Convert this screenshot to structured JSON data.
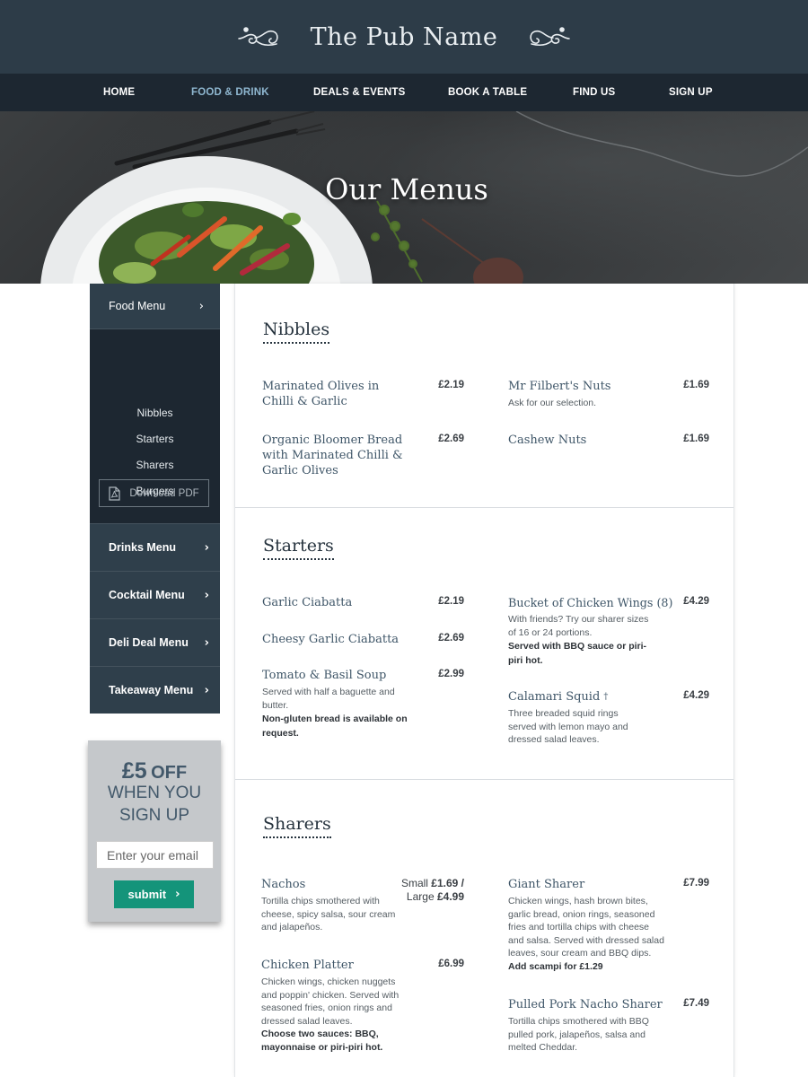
{
  "header": {
    "title": "The Pub Name"
  },
  "nav": {
    "items": [
      {
        "label": "HOME"
      },
      {
        "label": "FOOD & DRINK"
      },
      {
        "label": "DEALS & EVENTS"
      },
      {
        "label": "BOOK A TABLE"
      },
      {
        "label": "FIND US"
      },
      {
        "label": "SIGN UP"
      }
    ],
    "active": "FOOD & DRINK",
    "active_color": "#8fb7d0"
  },
  "hero": {
    "title": "Our Menus"
  },
  "sidebar": {
    "food_menu": "Food Menu",
    "sub_items": [
      "Nibbles",
      "Starters",
      "Sharers",
      "Burgers"
    ],
    "download_pdf": "Download PDF",
    "menus": [
      "Drinks Menu",
      "Cocktail Menu",
      "Deli Deal Menu",
      "Takeaway Menu"
    ],
    "chevron_icon": "chevron-right-icon"
  },
  "promo": {
    "amount": "£5",
    "off": "OFF",
    "line2": "WHEN YOU",
    "line3": "SIGN UP",
    "email_placeholder": "Enter your email",
    "submit_label": "submit",
    "submit_color": "#14947a"
  },
  "sections": {
    "nibbles": {
      "title": "Nibbles",
      "items": [
        {
          "name": "Marinated Olives in Chilli & Garlic",
          "price": "£2.19"
        },
        {
          "name": "Organic Bloomer Bread with Marinated Chilli & Garlic Olives",
          "price": "£2.69"
        },
        {
          "name": "Mr Filbert's Nuts",
          "price": "£1.69",
          "desc": "Ask for our selection."
        },
        {
          "name": "Cashew Nuts",
          "price": "£1.69"
        }
      ]
    },
    "starters": {
      "title": "Starters",
      "items": [
        {
          "name": "Garlic Ciabatta",
          "price": "£2.19"
        },
        {
          "name": "Cheesy Garlic Ciabatta",
          "price": "£2.69"
        },
        {
          "name": "Tomato & Basil Soup",
          "price": "£2.99",
          "desc": "Served with half a baguette and butter.",
          "note": "Non-gluten bread is available on request."
        },
        {
          "name": "Bucket of Chicken Wings (8)",
          "price": "£4.29",
          "desc": "With friends? Try our sharer sizes of 16 or 24 portions.",
          "note": "Served with BBQ sauce or piri-piri hot."
        },
        {
          "name": "Calamari Squid",
          "dagger": "†",
          "price": "£4.29",
          "desc": "Three breaded squid rings served with lemon mayo and dressed salad leaves."
        }
      ]
    },
    "sharers": {
      "title": "Sharers",
      "items": [
        {
          "name": "Nachos",
          "price_line1_label": "Small",
          "price_line1_value": "£1.69 /",
          "price_line2_label": "Large",
          "price_line2_value": "£4.99",
          "desc": "Tortilla chips smothered with cheese, spicy salsa, sour  cream and jalapeños."
        },
        {
          "name": "Chicken Platter",
          "price": "£6.99",
          "desc": "Chicken wings, chicken nuggets and poppin' chicken.  Served with seasoned fries, onion rings and dressed  salad leaves.",
          "note": "Choose two sauces: BBQ, mayonnaise or  piri-piri hot."
        },
        {
          "name": "Giant Sharer",
          "price": "£7.99",
          "desc": "Chicken wings, hash brown bites, garlic bread, onion  rings, seasoned fries and tortilla chips with cheese and salsa. Served with dressed salad leaves, sour cream and BBQ dips.",
          "note": "Add scampi for £1.29"
        },
        {
          "name": "Pulled Pork Nacho Sharer",
          "price": "£7.49",
          "desc": "Tortilla chips smothered with BBQ pulled pork, jalapeños,  salsa and melted Cheddar."
        }
      ]
    }
  }
}
